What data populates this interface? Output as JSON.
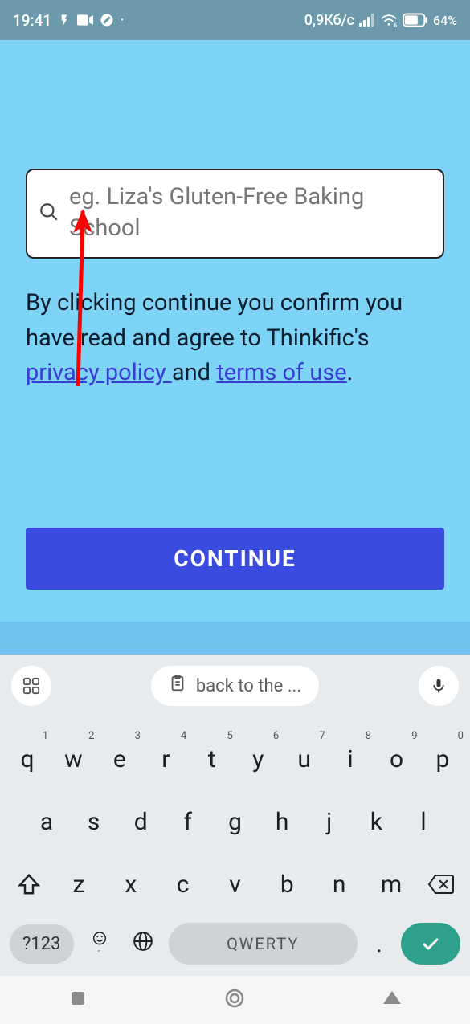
{
  "status_bar": {
    "time": "19:41",
    "network_speed": "0,9Кб/с",
    "battery_pct": "64%"
  },
  "search": {
    "placeholder": "eg. Liza's Gluten-Free Baking School",
    "value": ""
  },
  "consent": {
    "prefix": "By clicking continue you confirm you have read and agree to Thinkific's ",
    "privacy_label": "privacy policy ",
    "middle": "and ",
    "terms_label": "terms of use",
    "suffix": "."
  },
  "continue_label": "CONTINUE",
  "keyboard": {
    "suggestion": "back to the ...",
    "row1": [
      {
        "k": "q",
        "n": "1"
      },
      {
        "k": "w",
        "n": "2"
      },
      {
        "k": "e",
        "n": "3"
      },
      {
        "k": "r",
        "n": "4"
      },
      {
        "k": "t",
        "n": "5"
      },
      {
        "k": "y",
        "n": "6"
      },
      {
        "k": "u",
        "n": "7"
      },
      {
        "k": "i",
        "n": "8"
      },
      {
        "k": "o",
        "n": "9"
      },
      {
        "k": "p",
        "n": "0"
      }
    ],
    "row2": [
      "a",
      "s",
      "d",
      "f",
      "g",
      "h",
      "j",
      "k",
      "l"
    ],
    "row3": [
      "z",
      "x",
      "c",
      "v",
      "b",
      "n",
      "m"
    ],
    "symbols_label": "?123",
    "space_label": "QWERTY",
    "period": "."
  }
}
